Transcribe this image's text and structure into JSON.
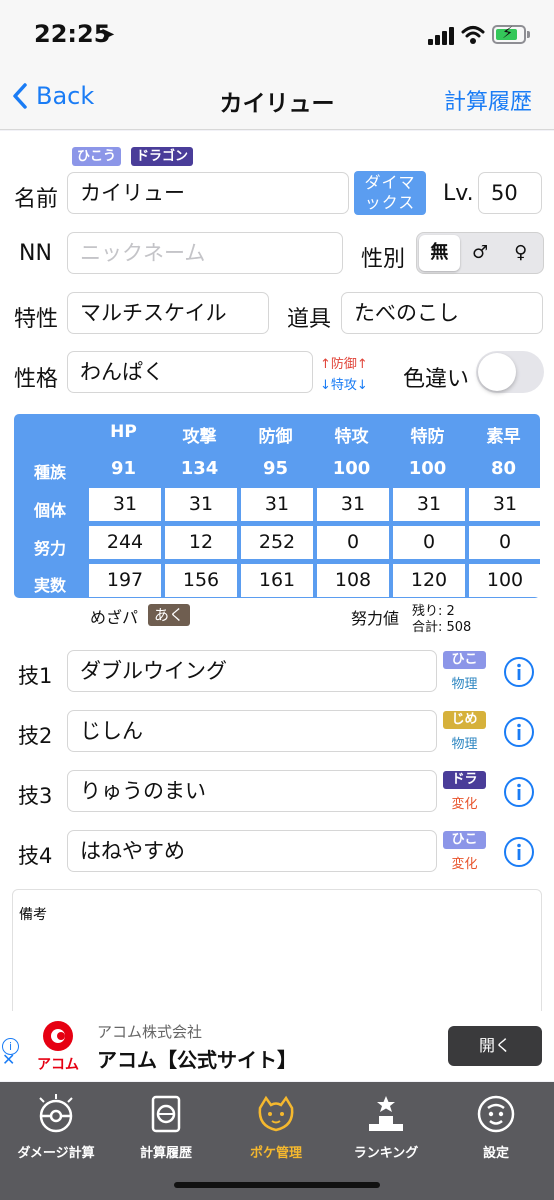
{
  "status_bar": {
    "time": "22:25"
  },
  "nav": {
    "back_label": "Back",
    "title": "カイリュー",
    "history_label": "計算履歴"
  },
  "types": [
    {
      "label": "ひこう",
      "color": "#8c96e8"
    },
    {
      "label": "ドラゴン",
      "color": "#4a3d99"
    }
  ],
  "form": {
    "name_label": "名前",
    "name_value": "カイリュー",
    "dmax_label_1": "ダイマ",
    "dmax_label_2": "ックス",
    "lv_label": "Lv.",
    "lv_value": "50",
    "nn_label": "NN",
    "nn_placeholder": "ニックネーム",
    "gender_label": "性別",
    "gender_options": [
      "無",
      "♂",
      "♀"
    ],
    "gender_selected": "無",
    "ability_label": "特性",
    "ability_value": "マルチスケイル",
    "item_label": "道具",
    "item_value": "たべのこし",
    "nature_label": "性格",
    "nature_value": "わんぱく",
    "nature_up": "↑防御↑",
    "nature_down": "↓特攻↓",
    "shiny_label": "色違い",
    "shiny_on": false
  },
  "stats": {
    "headers": [
      "HP",
      "攻撃",
      "防御",
      "特攻",
      "特防",
      "素早"
    ],
    "row_labels": [
      "種族",
      "個体",
      "努力",
      "実数"
    ],
    "base": [
      "91",
      "134",
      "95",
      "100",
      "100",
      "80"
    ],
    "iv": [
      "31",
      "31",
      "31",
      "31",
      "31",
      "31"
    ],
    "ev": [
      "244",
      "12",
      "252",
      "0",
      "0",
      "0"
    ],
    "actual": [
      "197",
      "156",
      "161",
      "108",
      "120",
      "100"
    ]
  },
  "hidden_power": {
    "label": "めざパ",
    "type": "あく",
    "color": "#6f5e50"
  },
  "ev_summary": {
    "label": "努力値",
    "remaining": "残り: 2",
    "total": "合計: 508"
  },
  "moves": [
    {
      "label": "技1",
      "name": "ダブルウイング",
      "type": "ひこ",
      "type_color": "#8c96e8",
      "category": "物理",
      "category_color": "#2e86c1"
    },
    {
      "label": "技2",
      "name": "じしん",
      "type": "じめ",
      "type_color": "#d6b13b",
      "category": "物理",
      "category_color": "#2e86c1"
    },
    {
      "label": "技3",
      "name": "りゅうのまい",
      "type": "ドラ",
      "type_color": "#4a3d99",
      "category": "変化",
      "category_color": "#e8552e"
    },
    {
      "label": "技4",
      "name": "はねやすめ",
      "type": "ひこ",
      "type_color": "#8c96e8",
      "category": "変化",
      "category_color": "#e8552e"
    }
  ],
  "memo": {
    "label": "備考"
  },
  "ad": {
    "logo_text": "アコム",
    "company": "アコム株式会社",
    "title": "アコム【公式サイト】",
    "open_label": "開く"
  },
  "tabs": [
    {
      "label": "ダメージ計算",
      "icon": "damage-calc-icon",
      "active": false
    },
    {
      "label": "計算履歴",
      "icon": "history-icon",
      "active": false
    },
    {
      "label": "ポケ管理",
      "icon": "poke-manage-icon",
      "active": true
    },
    {
      "label": "ランキング",
      "icon": "ranking-icon",
      "active": false
    },
    {
      "label": "設定",
      "icon": "settings-icon",
      "active": false
    }
  ],
  "colors": {
    "accent": "#1a7cf5",
    "stats_panel": "#5b9df0",
    "tab_active": "#f5b82e",
    "tab_bg": "#5a5a5e"
  }
}
